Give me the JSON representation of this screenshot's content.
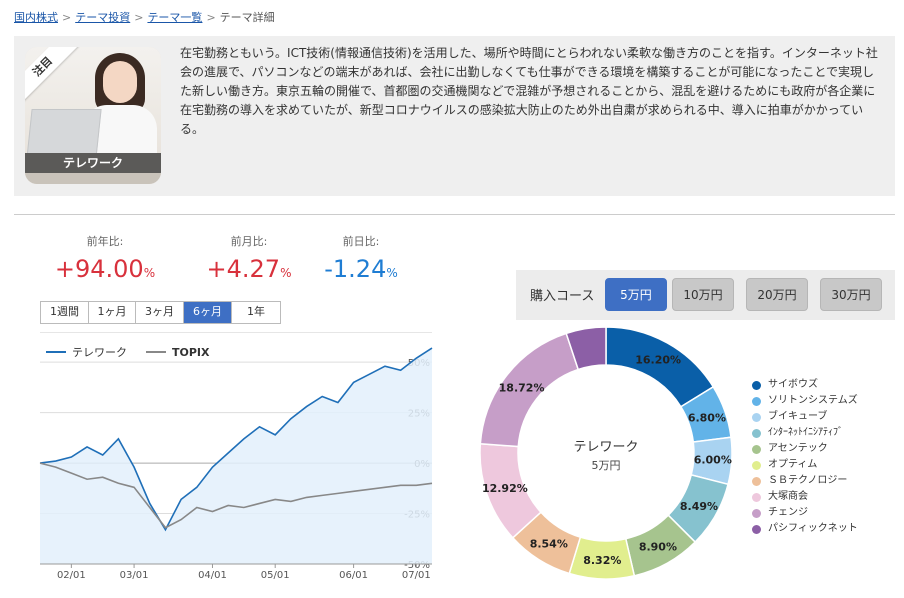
{
  "breadcrumb": {
    "items": [
      "国内株式",
      "テーマ投資",
      "テーマ一覧"
    ],
    "current": "テーマ詳細",
    "separator": ">"
  },
  "theme": {
    "badge": "注目",
    "name": "テレワーク",
    "description": "在宅勤務ともいう。ICT技術(情報通信技術)を活用した、場所や時間にとらわれない柔軟な働き方のことを指す。インターネット社会の進展で、パソコンなどの端末があれば、会社に出勤しなくても仕事ができる環境を構築することが可能になったことで実現した新しい働き方。東京五輪の開催で、首都圏の交通機関などで混雑が予想されることから、混乱を避けるためにも政府が各企業に在宅勤務の導入を求めていたが、新型コロナウイルスの感染拡大防止のため外出自粛が求められる中、導入に拍車がかかっている。"
  },
  "performance": [
    {
      "label": "前年比:",
      "value": "+94.00",
      "unit": "%",
      "sign": "pos"
    },
    {
      "label": "前月比:",
      "value": "+4.27",
      "unit": "%",
      "sign": "pos"
    },
    {
      "label": "前日比:",
      "value": "-1.24",
      "unit": "%",
      "sign": "neg"
    }
  ],
  "periods": {
    "tabs": [
      "1週間",
      "1ヶ月",
      "3ヶ月",
      "6ヶ月",
      "1年"
    ],
    "active": 3
  },
  "colors": {
    "theme_line": "#1f6fb8",
    "topix_line": "#888888",
    "area_fill": "#e3f0fb",
    "active_blue": "#3e6fc4"
  },
  "chart_data": [
    {
      "type": "line",
      "title": "",
      "series": [
        {
          "name": "テレワーク",
          "color": "#1f6fb8",
          "x": [
            "01/19",
            "01/26",
            "02/02",
            "02/09",
            "02/16",
            "02/23",
            "03/01",
            "03/08",
            "03/15",
            "03/22",
            "03/29",
            "04/05",
            "04/12",
            "04/19",
            "04/26",
            "05/03",
            "05/10",
            "05/17",
            "05/24",
            "05/31",
            "06/07",
            "06/14",
            "06/21",
            "06/28",
            "07/05",
            "07/12"
          ],
          "values": [
            0,
            1,
            3,
            8,
            4,
            12,
            -2,
            -20,
            -33,
            -18,
            -12,
            -2,
            5,
            12,
            18,
            14,
            22,
            28,
            33,
            30,
            40,
            44,
            48,
            46,
            52,
            57
          ]
        },
        {
          "name": "TOPIX",
          "color": "#888888",
          "x": [
            "01/19",
            "01/26",
            "02/02",
            "02/09",
            "02/16",
            "02/23",
            "03/01",
            "03/08",
            "03/15",
            "03/22",
            "03/29",
            "04/05",
            "04/12",
            "04/19",
            "04/26",
            "05/03",
            "05/10",
            "05/17",
            "05/24",
            "05/31",
            "06/07",
            "06/14",
            "06/21",
            "06/28",
            "07/05",
            "07/12"
          ],
          "values": [
            0,
            -2,
            -5,
            -8,
            -7,
            -10,
            -12,
            -22,
            -32,
            -28,
            -22,
            -24,
            -21,
            -22,
            -20,
            -18,
            -19,
            -17,
            -16,
            -15,
            -14,
            -13,
            -12,
            -11,
            -11,
            -10
          ]
        }
      ],
      "x_ticks": [
        "02/01",
        "03/01",
        "04/01",
        "05/01",
        "06/01",
        "07/01"
      ],
      "y_ticks": [
        "50%",
        "25%",
        "0%",
        "-25%",
        "-50%"
      ],
      "y_tick_values": [
        50,
        25,
        0,
        -25,
        -50
      ],
      "ylim": [
        -50,
        60
      ],
      "grid": true,
      "legend": "top-left"
    },
    {
      "type": "pie",
      "title": "",
      "center_title": "テレワーク",
      "center_sub": "5万円",
      "slices": [
        {
          "name": "サイボウズ",
          "value": 16.2,
          "label": "16.20%",
          "color": "#0a5fa8"
        },
        {
          "name": "ソリトンシステムズ",
          "value": 6.8,
          "label": "6.80%",
          "color": "#62b3e8"
        },
        {
          "name": "ブイキューブ",
          "value": 6.0,
          "label": "6.00%",
          "color": "#a9d3f1"
        },
        {
          "name": "ｲﾝﾀｰﾈｯﾄｲﾆｼｱﾃｨﾌﾞ",
          "value": 8.49,
          "label": "8.49%",
          "color": "#86c2cf"
        },
        {
          "name": "アセンテック",
          "value": 8.9,
          "label": "8.90%",
          "color": "#a6c48e"
        },
        {
          "name": "オプティム",
          "value": 8.32,
          "label": "8.32%",
          "color": "#e1ee8e"
        },
        {
          "name": "ＳＢテクノロジー",
          "value": 8.54,
          "label": "8.54%",
          "color": "#eec09a"
        },
        {
          "name": "大塚商会",
          "value": 12.92,
          "label": "12.92%",
          "color": "#eec8dd"
        },
        {
          "name": "チェンジ",
          "value": 18.72,
          "label": "18.72%",
          "color": "#c69ec8"
        },
        {
          "name": "パシフィックネット",
          "value": 5.11,
          "label": "",
          "color": "#8c5fa6"
        }
      ],
      "legend": "right"
    }
  ],
  "course": {
    "label": "購入コース",
    "options": [
      "5万円",
      "10万円",
      "20万円",
      "30万円"
    ],
    "active": 0
  }
}
